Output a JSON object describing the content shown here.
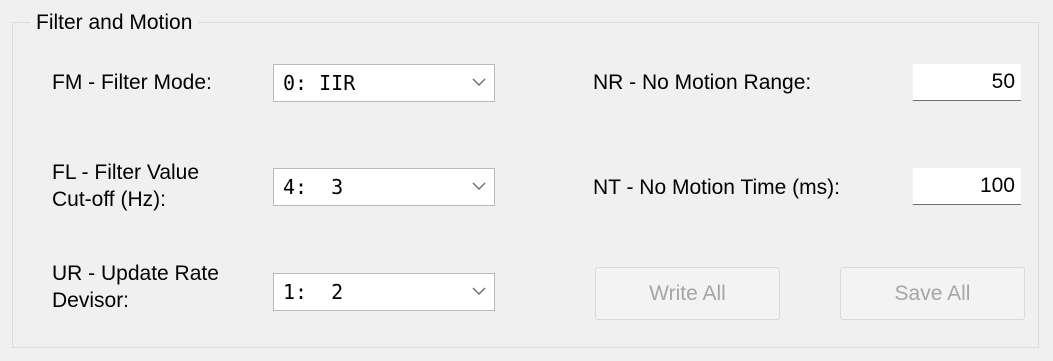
{
  "group": {
    "title": "Filter and Motion"
  },
  "filter_mode": {
    "label": "FM - Filter Mode:",
    "value": "0: IIR"
  },
  "filter_value": {
    "label_line1": "FL - Filter Value",
    "label_line2": "Cut-off (Hz):",
    "value": "4:  3"
  },
  "update_rate": {
    "label_line1": "UR - Update Rate",
    "label_line2": "Devisor:",
    "value": "1:  2"
  },
  "no_motion_range": {
    "label": "NR - No Motion Range:",
    "value": "50"
  },
  "no_motion_time": {
    "label": "NT - No Motion Time (ms):",
    "value": "100"
  },
  "buttons": {
    "write_all": "Write All",
    "save_all": "Save All"
  },
  "icons": {
    "dropdown": "chevron-down-icon"
  }
}
